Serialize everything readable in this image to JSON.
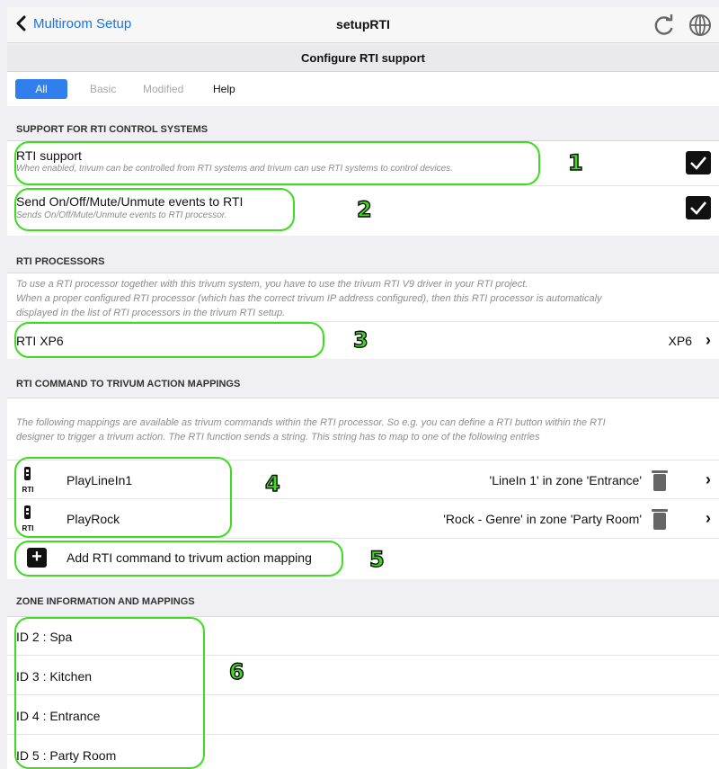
{
  "header": {
    "back_label": "Multiroom Setup",
    "title": "setupRTI",
    "subtitle": "Configure RTI support"
  },
  "tabs": [
    {
      "label": "All",
      "active": true
    },
    {
      "label": "Basic",
      "active": false
    },
    {
      "label": "Modified",
      "active": false
    },
    {
      "label": "Help",
      "active": false
    }
  ],
  "support": {
    "header": "SUPPORT FOR RTI CONTROL SYSTEMS",
    "rows": [
      {
        "title": "RTI support",
        "desc": "When enabled, trivum can be controlled from RTI systems and trivum can use RTI systems to control devices.",
        "checked": true
      },
      {
        "title": "Send On/Off/Mute/Unmute events to RTI",
        "desc": "Sends On/Off/Mute/Unmute events to RTI processor.",
        "checked": true
      }
    ]
  },
  "processors": {
    "header": "RTI PROCESSORS",
    "info": [
      "To use a RTI processor together with this trivum system, you have to use the trivum RTI V9 driver in your RTI project.",
      "When a proper configured RTI processor (which has the correct trivum IP address configured), then this RTI processor is automaticaly",
      "displayed in the list of RTI processors in the trivum RTI setup."
    ],
    "item": {
      "name": "RTI XP6",
      "model": "XP6"
    }
  },
  "mappings": {
    "header": "RTI COMMAND TO TRIVUM ACTION MAPPINGS",
    "info": [
      "The following mappings are available as trivum commands within the RTI processor. So e.g. you can define a RTI button within the RTI",
      "designer to trigger a trivum action. The RTI function sends a string. This string has to map to one of the following entries"
    ],
    "items": [
      {
        "name": "PlayLineIn1",
        "action": "'LineIn 1' in zone 'Entrance'",
        "icon_label": "RTI"
      },
      {
        "name": "PlayRock",
        "action": "'Rock - Genre' in zone 'Party Room'",
        "icon_label": "RTI"
      }
    ],
    "add_label": "Add RTI command to trivum action mapping"
  },
  "zones": {
    "header": "ZONE INFORMATION AND MAPPINGS",
    "items": [
      "ID 2 : Spa",
      "ID 3 : Kitchen",
      "ID 4 : Entrance",
      "ID 5 : Party Room"
    ]
  },
  "annotations": [
    "1",
    "2",
    "3",
    "4",
    "5",
    "6"
  ],
  "colors": {
    "accent": "#2f80ed",
    "annotation": "#3ddc1f",
    "back_link": "#1a73e8"
  }
}
